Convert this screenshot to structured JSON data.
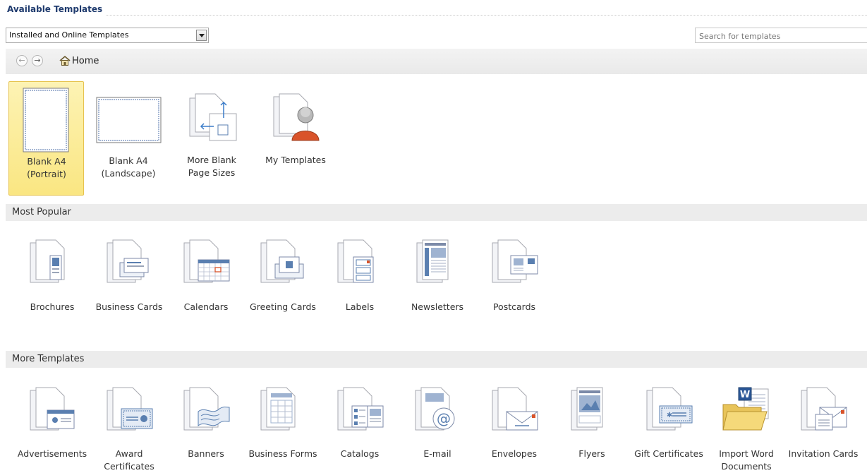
{
  "header": {
    "title": "Available Templates"
  },
  "filter": {
    "selected": "Installed and Online Templates"
  },
  "search": {
    "placeholder": "Search for templates"
  },
  "nav": {
    "back": "←",
    "forward": "→",
    "home_label": "Home"
  },
  "blank": {
    "portrait": "Blank A4\n(Portrait)",
    "landscape": "Blank A4\n(Landscape)",
    "more": "More Blank\nPage Sizes",
    "mine": "My Templates"
  },
  "sections": {
    "popular": {
      "title": "Most Popular"
    },
    "more": {
      "title": "More Templates"
    }
  },
  "popular": {
    "brochures": "Brochures",
    "business_cards": "Business Cards",
    "calendars": "Calendars",
    "greeting_cards": "Greeting Cards",
    "labels": "Labels",
    "newsletters": "Newsletters",
    "postcards": "Postcards"
  },
  "more": {
    "advertisements": "Advertisements",
    "award": "Award\nCertificates",
    "banners": "Banners",
    "business_forms": "Business Forms",
    "catalogs": "Catalogs",
    "email": "E-mail",
    "envelopes": "Envelopes",
    "flyers": "Flyers",
    "gift": "Gift Certificates",
    "import_word": "Import Word\nDocuments",
    "invitation": "Invitation Cards"
  },
  "colors": {
    "title": "#1f3b6e",
    "selection": "#fae682",
    "accent": "#5a7fb0",
    "header_bg": "#ececec"
  }
}
